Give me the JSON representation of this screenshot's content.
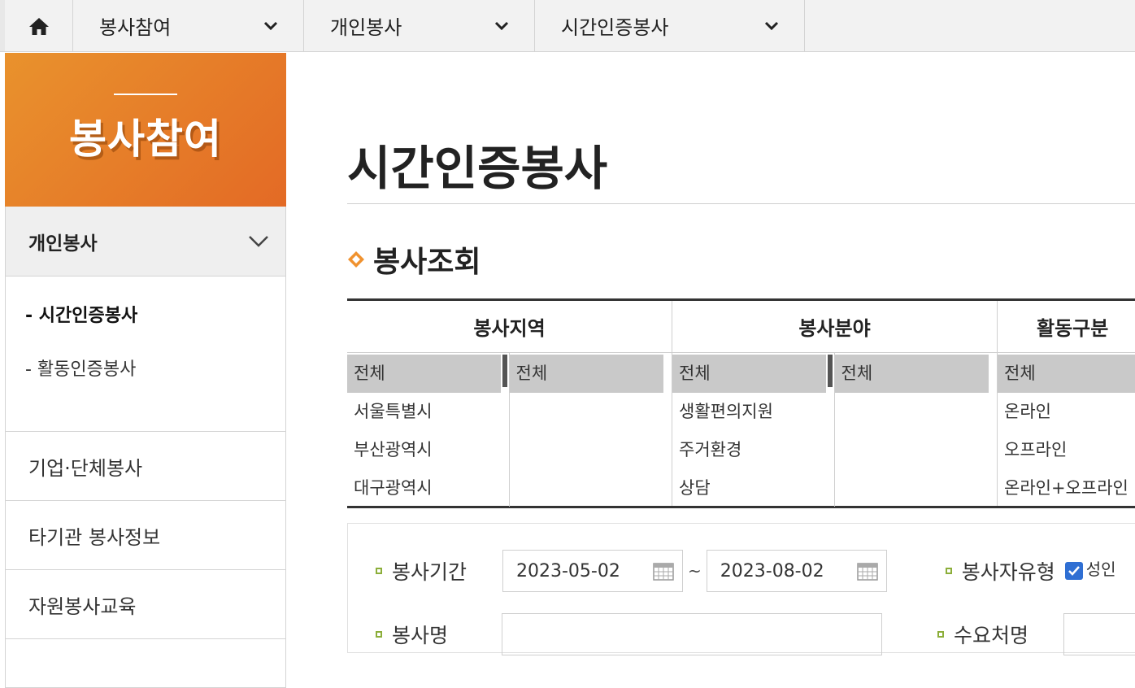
{
  "topnav": {
    "home_icon": "home-icon",
    "menus": [
      {
        "label": "봉사참여"
      },
      {
        "label": "개인봉사"
      },
      {
        "label": "시간인증봉사"
      }
    ]
  },
  "sidebar": {
    "title": "봉사참여",
    "submenu_title": "개인봉사",
    "sub_items": [
      "- 시간인증봉사",
      "- 활동인증봉사"
    ],
    "items": [
      "기업·단체봉사",
      "타기관 봉사정보",
      "자원봉사교육"
    ]
  },
  "main": {
    "page_title": "시간인증봉사",
    "section_title": "봉사조회",
    "filters": {
      "region": {
        "header": "봉사지역",
        "list1": [
          "전체",
          "서울특별시",
          "부산광역시",
          "대구광역시"
        ],
        "list2": [
          "전체"
        ]
      },
      "field": {
        "header": "봉사분야",
        "list1": [
          "전체",
          "생활편의지원",
          "주거환경",
          "상담"
        ],
        "list2": [
          "전체"
        ]
      },
      "activity": {
        "header": "활동구분",
        "list1": [
          "전체",
          "온라인",
          "오프라인",
          "온라인+오프라인"
        ]
      }
    },
    "search": {
      "period_label": "봉사기간",
      "start_date": "2023-05-02",
      "tilde": "~",
      "end_date": "2023-08-02",
      "volunteer_type_label": "봉사자유형",
      "adult_label": "성인",
      "adult_checked": true,
      "name_label": "봉사명",
      "demand_label": "수요처명"
    }
  },
  "colors": {
    "accent_orange": "#e36a25",
    "bullet_green": "#8cae3a",
    "checkbox_blue": "#2f6fd3"
  }
}
